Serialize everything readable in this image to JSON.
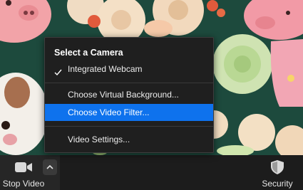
{
  "menu": {
    "heading": "Select a Camera",
    "camera_option": "Integrated Webcam",
    "virtual_background": "Choose Virtual Background...",
    "video_filter": "Choose Video Filter...",
    "video_settings": "Video Settings..."
  },
  "toolbar": {
    "stop_video_label": "Stop Video",
    "security_label": "Security"
  },
  "colors": {
    "highlight": "#0e72ed",
    "menu_background": "#1f1f1f",
    "toolbar_background": "#1c1c1c"
  },
  "icons": [
    "video-camera-icon",
    "chevron-up-icon",
    "checkmark-icon",
    "shield-icon"
  ]
}
